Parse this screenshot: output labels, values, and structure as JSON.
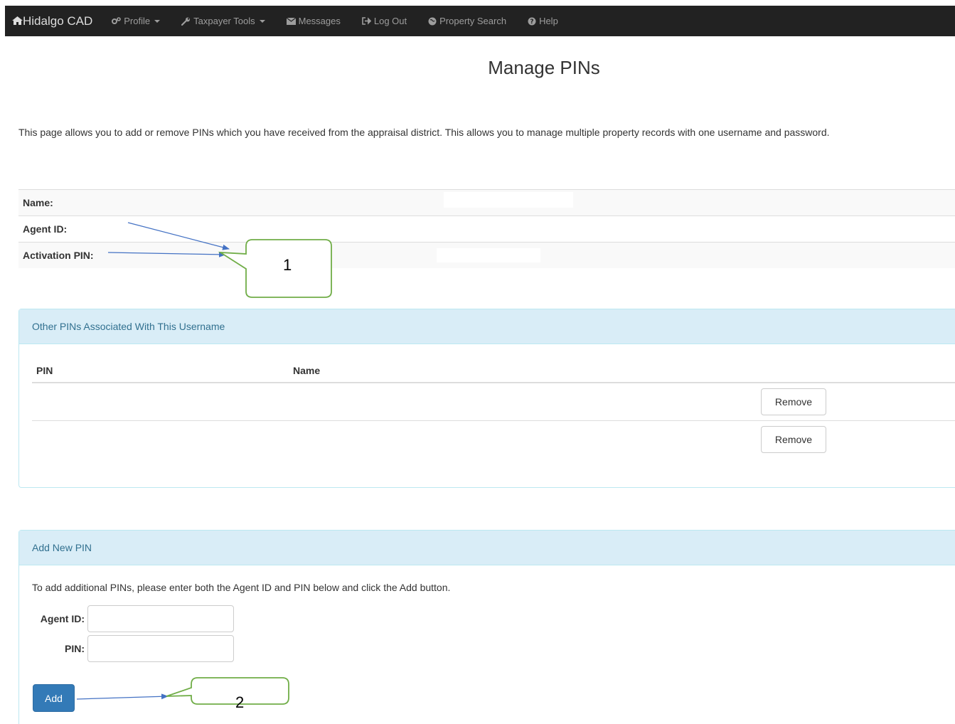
{
  "navbar": {
    "brand": "Hidalgo CAD",
    "items": [
      {
        "label": "Profile",
        "icon": "gears-icon",
        "dropdown": true
      },
      {
        "label": "Taxpayer Tools",
        "icon": "wrench-icon",
        "dropdown": true
      },
      {
        "label": "Messages",
        "icon": "envelope-icon",
        "dropdown": false
      },
      {
        "label": "Log Out",
        "icon": "sign-out-icon",
        "dropdown": false
      },
      {
        "label": "Property Search",
        "icon": "globe-icon",
        "dropdown": false
      },
      {
        "label": "Help",
        "icon": "question-circle-icon",
        "dropdown": false
      }
    ]
  },
  "page": {
    "title": "Manage PINs",
    "intro": "This page allows you to add or remove PINs which you have received from the appraisal district. This allows you to manage multiple property records with one username and password."
  },
  "account_info": {
    "name_label": "Name:",
    "agent_id_label": "Agent ID:",
    "activation_pin_label": "Activation PIN:"
  },
  "other_pins_panel": {
    "heading": "Other PINs Associated With This Username",
    "columns": [
      "PIN",
      "Name"
    ],
    "rows": [
      {
        "pin": "",
        "name": "",
        "action": "Remove"
      },
      {
        "pin": "",
        "name": "",
        "action": "Remove"
      }
    ]
  },
  "add_pin_panel": {
    "heading": "Add New PIN",
    "description": "To add additional PINs, please enter both the Agent ID and PIN below and click the Add button.",
    "agent_id_label": "Agent ID:",
    "agent_id_value": "",
    "pin_label": "PIN:",
    "pin_value": "",
    "add_button": "Add"
  },
  "annotations": {
    "callout_1": "1",
    "callout_2": "2",
    "callout_border_color": "#70ad47",
    "arrow_color": "#4472c4"
  },
  "colors": {
    "navbar_bg": "#222222",
    "panel_heading_bg": "#d9edf7",
    "panel_heading_text": "#31708f",
    "primary_button": "#337ab7"
  }
}
